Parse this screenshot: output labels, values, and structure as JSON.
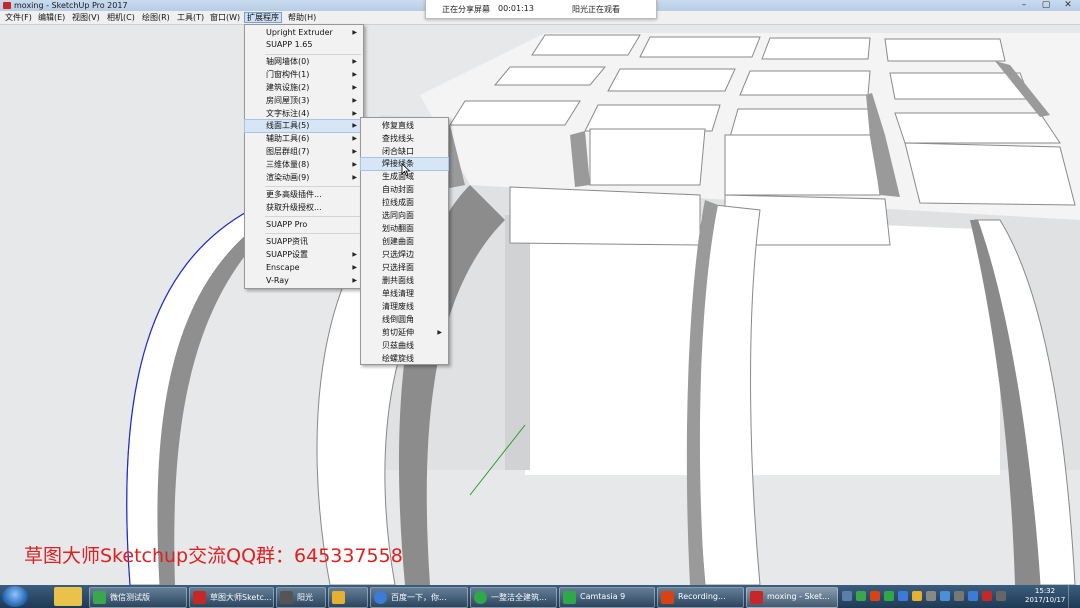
{
  "window": {
    "title": "moxing - SketchUp Pro 2017",
    "controls": [
      "–",
      "▢",
      "✕"
    ]
  },
  "menubar": [
    "文件(F)",
    "编辑(E)",
    "视图(V)",
    "相机(C)",
    "绘图(R)",
    "工具(T)",
    "窗口(W)",
    "扩展程序",
    "帮助(H)"
  ],
  "share_bar": {
    "sharing": "正在分享屏幕",
    "time": "00:01:13",
    "viewer": "阳光正在观看"
  },
  "ext_menu": {
    "items": [
      {
        "label": "Upright Extruder",
        "arrow": true
      },
      {
        "label": "SUAPP 1.65",
        "arrow": false
      },
      {
        "label": "轴网墙体(0)",
        "arrow": true
      },
      {
        "label": "门窗构件(1)",
        "arrow": true
      },
      {
        "label": "建筑设施(2)",
        "arrow": true
      },
      {
        "label": "房间屋顶(3)",
        "arrow": true
      },
      {
        "label": "文字标注(4)",
        "arrow": true
      },
      {
        "label": "线面工具(5)",
        "arrow": true,
        "highlight": true
      },
      {
        "label": "辅助工具(6)",
        "arrow": true
      },
      {
        "label": "图层群组(7)",
        "arrow": true
      },
      {
        "label": "三维体量(8)",
        "arrow": true
      },
      {
        "label": "渲染动画(9)",
        "arrow": true
      },
      {
        "label": "更多高级插件...",
        "arrow": false
      },
      {
        "label": "获取升级授权...",
        "arrow": false
      },
      {
        "label": "SUAPP Pro",
        "arrow": false
      },
      {
        "label": "SUAPP资讯",
        "arrow": false
      },
      {
        "label": "SUAPP设置",
        "arrow": true
      },
      {
        "label": "Enscape",
        "arrow": true
      },
      {
        "label": "V-Ray",
        "arrow": true
      }
    ]
  },
  "sub_menu": {
    "items": [
      {
        "label": "修复直线"
      },
      {
        "label": "查找线头"
      },
      {
        "label": "闭合缺口"
      },
      {
        "label": "焊接线条",
        "highlight": true
      },
      {
        "label": "生成面域"
      },
      {
        "label": "自动封面"
      },
      {
        "label": "拉线成面"
      },
      {
        "label": "选同向面"
      },
      {
        "label": "划动翻面"
      },
      {
        "label": "创建曲面"
      },
      {
        "label": "只选焊边"
      },
      {
        "label": "只选择面"
      },
      {
        "label": "删共面线"
      },
      {
        "label": "单线清理"
      },
      {
        "label": "清理废线"
      },
      {
        "label": "线倒圆角"
      },
      {
        "label": "剪切延伸",
        "arrow": true
      },
      {
        "label": "贝兹曲线"
      },
      {
        "label": "绘螺旋线"
      }
    ]
  },
  "caption": "草图大师Sketchup交流QQ群：645337558",
  "taskbar": {
    "tasks": [
      {
        "label": "微信测试版",
        "color": "#3aa84a"
      },
      {
        "label": "草图大师Sketc...",
        "color": "#c62828"
      },
      {
        "label": "阳光",
        "color": "#555555"
      },
      {
        "label": "",
        "color": "#e8b030"
      },
      {
        "label": "百度一下，你...",
        "color": "#3d7bd8"
      },
      {
        "label": "一整洁全建筑...",
        "color": "#2fa84a"
      },
      {
        "label": "Camtasia 9",
        "color": "#2fa84a"
      },
      {
        "label": "Recording...",
        "color": "#d84315"
      },
      {
        "label": "moxing - Sket...",
        "color": "#c62828"
      }
    ],
    "clock_time": "15:32",
    "clock_date": "2017/10/17"
  },
  "colors": {
    "caption": "#e02020",
    "menu_highlight": "#d6e6f7",
    "taskbar": "#2a4a6a"
  }
}
